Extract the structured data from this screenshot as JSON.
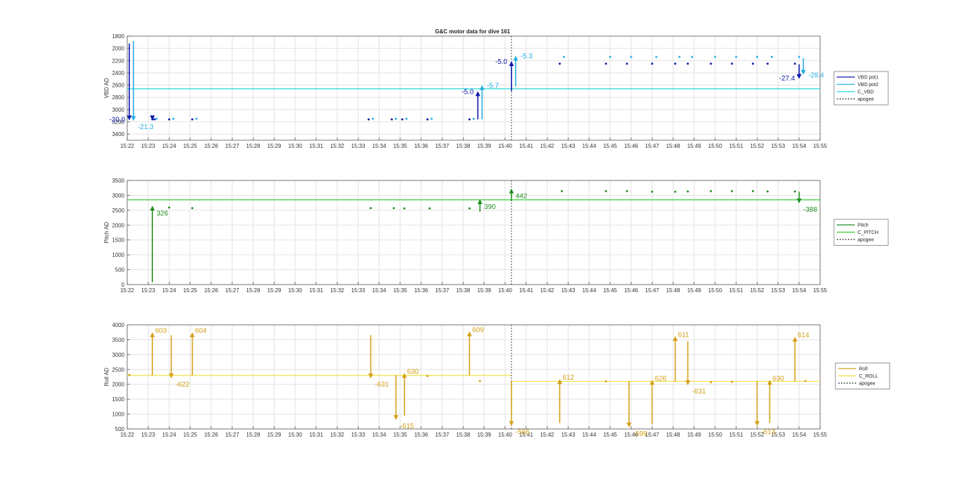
{
  "figure_title": "G&C motor data for dive 161",
  "colors": {
    "vbd_pot1": "#0a17a8",
    "vbd_pot2": "#27aee0",
    "c_vbd": "#22dada",
    "pitch": "#218c21",
    "c_pitch": "#33cc33",
    "roll": "#d4a017",
    "c_roll": "#f0e040",
    "apogee": "#333333",
    "grid": "#e2e2e2"
  },
  "chart_data": [
    {
      "type": "scatter",
      "title": "G&C motor data for dive 161",
      "ylabel": "VBD AD",
      "ylim": [
        1800,
        3500
      ],
      "y_reversed": true,
      "yticks": [
        1800,
        2000,
        2200,
        2400,
        2600,
        2800,
        3000,
        3200,
        3400
      ],
      "xlim": [
        "15:22",
        "15:55"
      ],
      "xticks": [
        "15:22",
        "15:23",
        "15:24",
        "15:25",
        "15:26",
        "15:27",
        "15:28",
        "15:29",
        "15:30",
        "15:31",
        "15:32",
        "15:33",
        "15:34",
        "15:35",
        "15:36",
        "15:37",
        "15:38",
        "15:39",
        "15:40",
        "15:41",
        "15:42",
        "15:43",
        "15:44",
        "15:45",
        "15:46",
        "15:47",
        "15:48",
        "15:49",
        "15:50",
        "15:51",
        "15:52",
        "15:53",
        "15:54",
        "15:55"
      ],
      "grid": true,
      "legend_position": "right",
      "legend": [
        "VBD pot1",
        "VBD pot2",
        "C_VBD",
        "apogee"
      ],
      "apogee_time": "15:40.3",
      "series": [
        {
          "name": "VBD pot1",
          "color": "vbd_pot1",
          "x": [
            "15:23.2",
            "15:23.3",
            "15:24.0",
            "15:25.1",
            "15:33.5",
            "15:34.6",
            "15:35.1",
            "15:36.3",
            "15:38.3",
            "15:42.6",
            "15:44.8",
            "15:45.8",
            "15:47.0",
            "15:48.1",
            "15:48.7",
            "15:49.8",
            "15:50.8",
            "15:51.8",
            "15:52.5",
            "15:53.8"
          ],
          "y": [
            3160,
            3160,
            3160,
            3160,
            3160,
            3160,
            3160,
            3160,
            3160,
            2250,
            2250,
            2250,
            2250,
            2250,
            2250,
            2250,
            2250,
            2250,
            2250,
            2250
          ]
        },
        {
          "name": "VBD pot2",
          "color": "vbd_pot2",
          "x": [
            "15:23.4",
            "15:24.2",
            "15:25.3",
            "15:33.7",
            "15:34.8",
            "15:35.3",
            "15:36.5",
            "15:38.5",
            "15:42.8",
            "15:45.0",
            "15:46.0",
            "15:47.2",
            "15:48.3",
            "15:48.9",
            "15:50.0",
            "15:51.0",
            "15:52.0",
            "15:52.7",
            "15:54.0"
          ],
          "y": [
            3150,
            3150,
            3150,
            3150,
            3150,
            3150,
            3150,
            3150,
            2140,
            2140,
            2140,
            2140,
            2140,
            2140,
            2140,
            2140,
            2140,
            2140,
            2140
          ]
        },
        {
          "name": "C_VBD",
          "color": "c_vbd",
          "type": "hline",
          "y": 2660
        }
      ],
      "arrows": [
        {
          "series": "VBD pot1",
          "x": "15:22.1",
          "from": 1920,
          "to": 3175,
          "label": "-20.0",
          "label_side": "left"
        },
        {
          "series": "VBD pot2",
          "x": "15:22.3",
          "from": 1880,
          "to": 3185,
          "label": "-21.3",
          "label_side": "right-below"
        },
        {
          "series": "VBD pot1",
          "x": "15:23.2",
          "from": 3150,
          "to": 3175,
          "label": "",
          "label_side": "none"
        },
        {
          "series": "VBD pot1",
          "x": "15:38.7",
          "from": 3160,
          "to": 2700,
          "label": "-5.0",
          "label_side": "left"
        },
        {
          "series": "VBD pot2",
          "x": "15:38.9",
          "from": 3160,
          "to": 2600,
          "label": "-5.7",
          "label_side": "right"
        },
        {
          "series": "VBD pot1",
          "x": "15:40.3",
          "from": 2700,
          "to": 2210,
          "label": "-5.0",
          "label_side": "left"
        },
        {
          "series": "VBD pot2",
          "x": "15:40.5",
          "from": 2620,
          "to": 2120,
          "label": "-5.3",
          "label_side": "right"
        },
        {
          "series": "VBD pot1",
          "x": "15:54.0",
          "from": 2260,
          "to": 2500,
          "label": "-27.4",
          "label_side": "left"
        },
        {
          "series": "VBD pot2",
          "x": "15:54.2",
          "from": 2160,
          "to": 2430,
          "label": "-28.4",
          "label_side": "right"
        }
      ]
    },
    {
      "type": "scatter",
      "ylabel": "Pitch AD",
      "ylim": [
        0,
        3500
      ],
      "yticks": [
        0,
        500,
        1000,
        1500,
        2000,
        2500,
        3000,
        3500
      ],
      "xlim": [
        "15:22",
        "15:55"
      ],
      "xticks": [
        "15:22",
        "15:23",
        "15:24",
        "15:25",
        "15:26",
        "15:27",
        "15:28",
        "15:29",
        "15:30",
        "15:31",
        "15:32",
        "15:33",
        "15:34",
        "15:35",
        "15:36",
        "15:37",
        "15:38",
        "15:39",
        "15:40",
        "15:41",
        "15:42",
        "15:43",
        "15:44",
        "15:45",
        "15:46",
        "15:47",
        "15:48",
        "15:49",
        "15:50",
        "15:51",
        "15:52",
        "15:53",
        "15:54",
        "15:55"
      ],
      "grid": true,
      "legend_position": "right",
      "legend": [
        "Pitch",
        "C_PITCH",
        "apogee"
      ],
      "apogee_time": "15:40.3",
      "series": [
        {
          "name": "Pitch",
          "color": "pitch",
          "x": [
            "15:24.0",
            "15:25.1",
            "15:33.6",
            "15:34.7",
            "15:35.2",
            "15:36.4",
            "15:38.3",
            "15:42.7",
            "15:44.8",
            "15:45.8",
            "15:47.0",
            "15:48.1",
            "15:48.7",
            "15:49.8",
            "15:50.8",
            "15:51.8",
            "15:52.5",
            "15:53.8"
          ],
          "y": [
            2590,
            2570,
            2570,
            2570,
            2560,
            2560,
            2560,
            3140,
            3140,
            3140,
            3120,
            3120,
            3130,
            3140,
            3140,
            3140,
            3130,
            3130
          ]
        },
        {
          "name": "C_PITCH",
          "color": "c_pitch",
          "type": "hline",
          "y": 2850
        }
      ],
      "arrows": [
        {
          "series": "Pitch",
          "x": "15:23.2",
          "from": 80,
          "to": 2650,
          "label": "326",
          "label_side": "right-below"
        },
        {
          "series": "Pitch",
          "x": "15:38.8",
          "from": 2450,
          "to": 2870,
          "label": "390",
          "label_side": "right-below"
        },
        {
          "series": "Pitch",
          "x": "15:40.3",
          "from": 2800,
          "to": 3230,
          "label": "442",
          "label_side": "right-below"
        },
        {
          "series": "Pitch",
          "x": "15:54.0",
          "from": 3120,
          "to": 2730,
          "label": "-388",
          "label_side": "right-below"
        }
      ]
    },
    {
      "type": "scatter",
      "ylabel": "Roll AD",
      "ylim": [
        500,
        4000
      ],
      "yticks": [
        500,
        1000,
        1500,
        2000,
        2500,
        3000,
        3500,
        4000
      ],
      "xlim": [
        "15:22",
        "15:55"
      ],
      "xticks": [
        "15:22",
        "15:23",
        "15:24",
        "15:25",
        "15:26",
        "15:27",
        "15:28",
        "15:29",
        "15:30",
        "15:31",
        "15:32",
        "15:33",
        "15:34",
        "15:35",
        "15:36",
        "15:37",
        "15:38",
        "15:39",
        "15:40",
        "15:41",
        "15:42",
        "15:43",
        "15:44",
        "15:45",
        "15:46",
        "15:47",
        "15:48",
        "15:49",
        "15:50",
        "15:51",
        "15:52",
        "15:53",
        "15:54",
        "15:55"
      ],
      "grid": true,
      "legend_position": "right",
      "legend": [
        "Roll",
        "C_ROLL",
        "apogee"
      ],
      "apogee_time": "15:40.3",
      "series": [
        {
          "name": "Roll",
          "color": "roll",
          "x": [
            "15:22.1",
            "15:36.3",
            "15:38.8",
            "15:44.8",
            "15:49.8",
            "15:50.8",
            "15:54.3"
          ],
          "y": [
            2310,
            2280,
            2110,
            2100,
            2070,
            2080,
            2110
          ]
        },
        {
          "name": "C_ROLL",
          "color": "c_roll",
          "type": "segments",
          "segments": [
            {
              "x0": "15:22",
              "x1": "15:40.3",
              "y": 2300
            },
            {
              "x0": "15:40.3",
              "x1": "15:55",
              "y": 2100
            }
          ]
        }
      ],
      "arrows": [
        {
          "series": "Roll",
          "x": "15:23.2",
          "from": 2300,
          "to": 3750,
          "label": "603",
          "label_side": "right-top"
        },
        {
          "series": "Roll",
          "x": "15:24.1",
          "from": 3650,
          "to": 2200,
          "label": "-622",
          "label_side": "right-below"
        },
        {
          "series": "Roll",
          "x": "15:25.1",
          "from": 2300,
          "to": 3750,
          "label": "604",
          "label_side": "right-top"
        },
        {
          "series": "Roll",
          "x": "15:33.6",
          "from": 3650,
          "to": 2200,
          "label": "-631",
          "label_side": "right-below"
        },
        {
          "series": "Roll",
          "x": "15:34.8",
          "from": 2300,
          "to": 800,
          "label": "-615",
          "label_side": "right-below"
        },
        {
          "series": "Roll",
          "x": "15:35.2",
          "from": 950,
          "to": 2380,
          "label": "630",
          "label_side": "right-top"
        },
        {
          "series": "Roll",
          "x": "15:38.3",
          "from": 2300,
          "to": 3780,
          "label": "609",
          "label_side": "right-top"
        },
        {
          "series": "Roll",
          "x": "15:40.3",
          "from": 2100,
          "to": 600,
          "label": "-586",
          "label_side": "right-below"
        },
        {
          "series": "Roll",
          "x": "15:42.6",
          "from": 700,
          "to": 2180,
          "label": "612",
          "label_side": "right-top"
        },
        {
          "series": "Roll",
          "x": "15:45.9",
          "from": 2100,
          "to": 550,
          "label": "-599",
          "label_side": "right-below"
        },
        {
          "series": "Roll",
          "x": "15:47.0",
          "from": 650,
          "to": 2150,
          "label": "626",
          "label_side": "right-top"
        },
        {
          "series": "Roll",
          "x": "15:48.1",
          "from": 2100,
          "to": 3620,
          "label": "611",
          "label_side": "right-top"
        },
        {
          "series": "Roll",
          "x": "15:48.7",
          "from": 3450,
          "to": 1970,
          "label": "-631",
          "label_side": "right-below"
        },
        {
          "series": "Roll",
          "x": "15:52.0",
          "from": 2100,
          "to": 600,
          "label": "-613",
          "label_side": "right-below"
        },
        {
          "series": "Roll",
          "x": "15:52.6",
          "from": 700,
          "to": 2150,
          "label": "630",
          "label_side": "right-top"
        },
        {
          "series": "Roll",
          "x": "15:53.8",
          "from": 2100,
          "to": 3600,
          "label": "614",
          "label_side": "right-top"
        }
      ]
    }
  ]
}
